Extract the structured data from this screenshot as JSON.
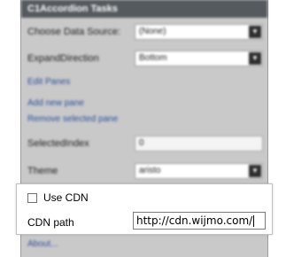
{
  "panel": {
    "title": "C1Accordion Tasks",
    "data_source": {
      "label": "Choose Data Source:",
      "value": "(None)"
    },
    "expand_direction": {
      "label": "ExpandDirection",
      "value": "Bottom"
    },
    "edit_panes_link": "Edit Panes",
    "add_pane_link": "Add new pane",
    "remove_pane_link": "Remove selected pane",
    "selected_index": {
      "label": "SelectedIndex",
      "value": "0"
    },
    "theme": {
      "label": "Theme",
      "value": "aristo"
    },
    "about_link": "About..."
  },
  "cdn": {
    "use_cdn_label": "Use CDN",
    "use_cdn_checked": false,
    "path_label": "CDN path",
    "path_value": "http://cdn.wijmo.com/"
  },
  "colors": {
    "title_bar": "#555a5f",
    "panel_bg": "#c9c9c9",
    "link": "#2a4e9e"
  }
}
